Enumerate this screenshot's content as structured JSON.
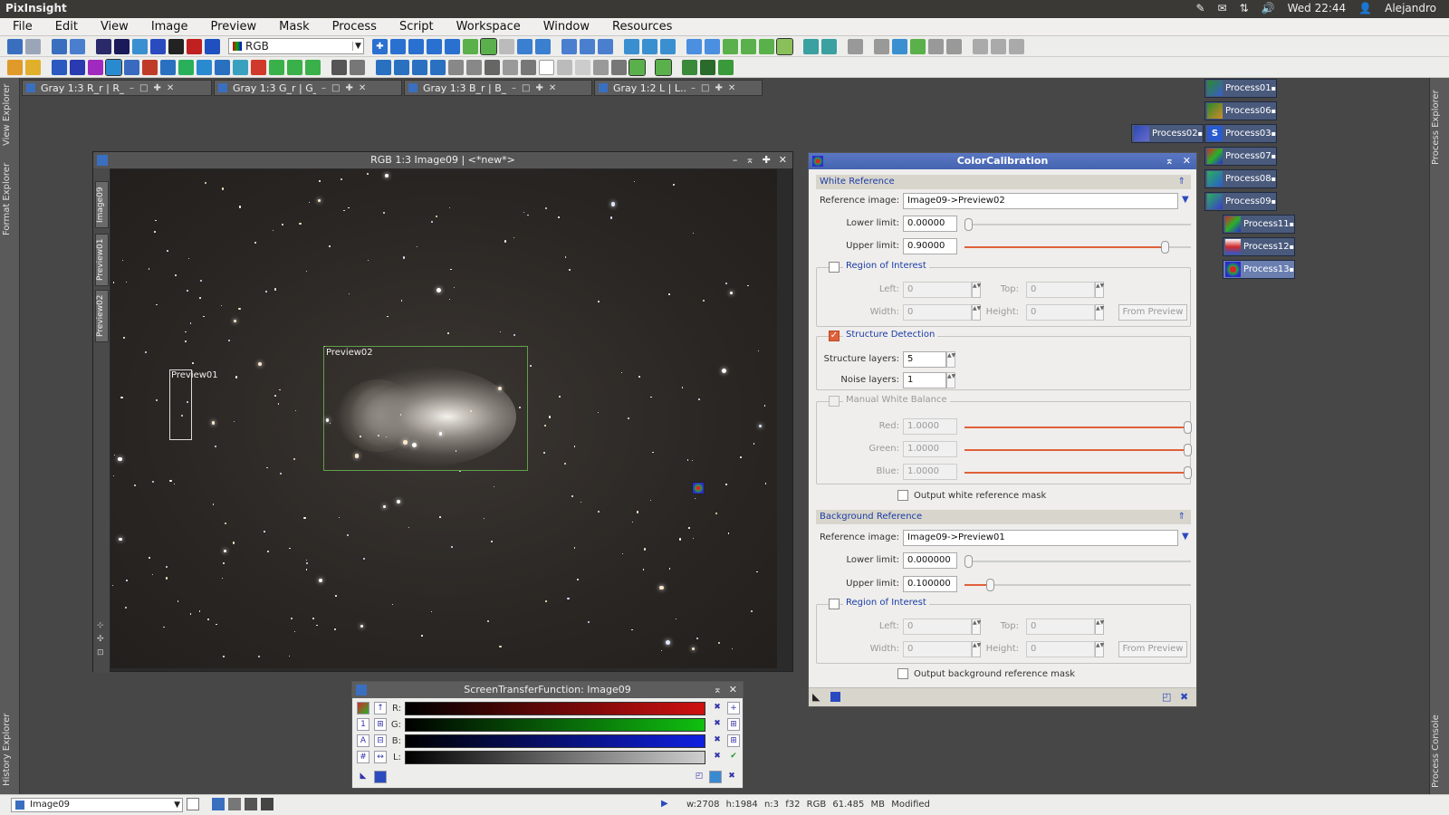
{
  "system": {
    "app_name": "PixInsight",
    "datetime": "Wed 22:44",
    "user": "Alejandro"
  },
  "menu": [
    "File",
    "Edit",
    "View",
    "Image",
    "Preview",
    "Mask",
    "Process",
    "Script",
    "Workspace",
    "Window",
    "Resources"
  ],
  "toolbar": {
    "channel_combo": "RGB"
  },
  "iconic_windows": [
    "Gray 1:3 R_r | R_r...",
    "Gray 1:3 G_r | G_r...",
    "Gray 1:3 B_r | B_r...",
    "Gray 1:2 L | L..."
  ],
  "side": {
    "left": [
      "View Explorer",
      "Format Explorer",
      "History Explorer"
    ],
    "right": [
      "Process Explorer",
      "Process Console"
    ]
  },
  "process_icons": [
    "Process01",
    "Process06",
    "Process02",
    "Process03",
    "Process07",
    "Process08",
    "Process09",
    "Process11",
    "Process12",
    "Process13"
  ],
  "image_window": {
    "title": "RGB 1:3 Image09 | <*new*>",
    "tabs": [
      "Image09",
      "Preview01",
      "Preview02"
    ],
    "preview01": "Preview01",
    "preview02": "Preview02"
  },
  "stf": {
    "title": "ScreenTransferFunction: Image09",
    "channels": [
      "R:",
      "G:",
      "B:",
      "L:"
    ],
    "colors": {
      "r": "#d01010",
      "g": "#10c010",
      "b": "#1020e0",
      "l": "#cfcfcf"
    }
  },
  "cc": {
    "title": "ColorCalibration",
    "white_ref": {
      "header": "White Reference",
      "ref_label": "Reference image:",
      "ref_value": "Image09->Preview02",
      "lower_label": "Lower limit:",
      "lower": "0.00000",
      "upper_label": "Upper limit:",
      "upper": "0.90000",
      "lower_frac": 0.0,
      "upper_frac": 0.9
    },
    "roi1": {
      "label": "Region of Interest",
      "left_label": "Left:",
      "left": "0",
      "top_label": "Top:",
      "top": "0",
      "width_label": "Width:",
      "width": "0",
      "height_label": "Height:",
      "height": "0",
      "from_preview": "From Preview"
    },
    "structure": {
      "label": "Structure Detection",
      "layers_label": "Structure layers:",
      "layers": "5",
      "noise_label": "Noise layers:",
      "noise": "1"
    },
    "mwb": {
      "label": "Manual White Balance",
      "red_label": "Red:",
      "red": "1.0000",
      "green_label": "Green:",
      "green": "1.0000",
      "blue_label": "Blue:",
      "blue": "1.0000"
    },
    "out_white": "Output white reference mask",
    "bg_ref": {
      "header": "Background Reference",
      "ref_label": "Reference image:",
      "ref_value": "Image09->Preview01",
      "lower_label": "Lower limit:",
      "lower": "0.000000",
      "upper_label": "Upper limit:",
      "upper": "0.100000",
      "lower_frac": 0.0,
      "upper_frac": 0.1
    },
    "roi2": {
      "label": "Region of Interest",
      "left_label": "Left:",
      "left": "0",
      "top_label": "Top:",
      "top": "0",
      "width_label": "Width:",
      "width": "0",
      "height_label": "Height:",
      "height": "0",
      "from_preview": "From Preview"
    },
    "out_bg": "Output background reference mask"
  },
  "status": {
    "image": "Image09",
    "info": "w:2708   h:1984   n:3   f32   RGB   61.485 MB   Modified"
  }
}
